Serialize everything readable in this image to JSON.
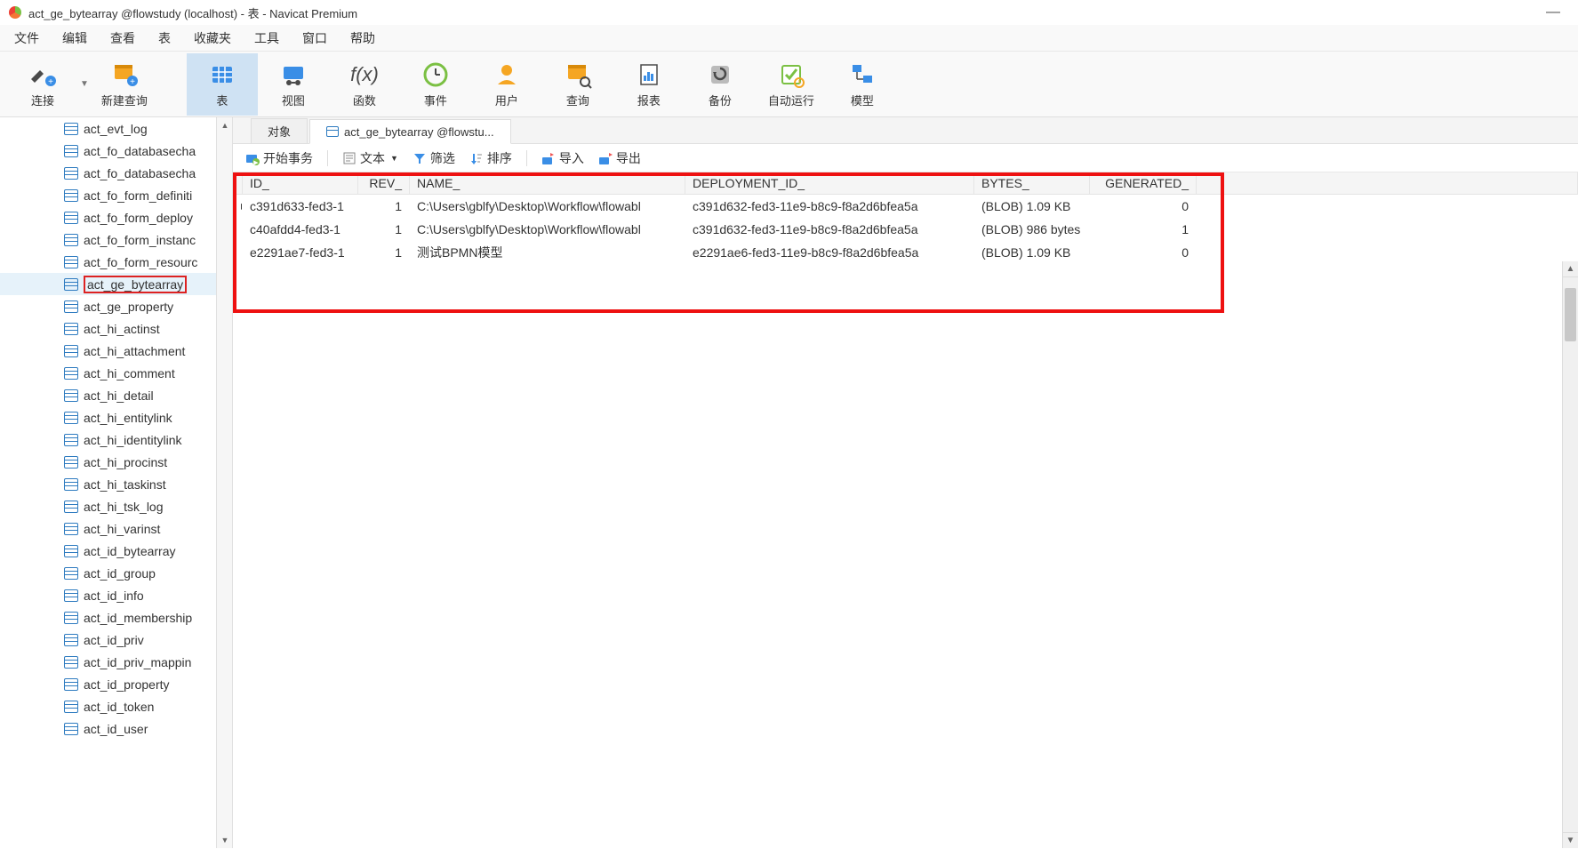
{
  "window": {
    "title": "act_ge_bytearray @flowstudy (localhost) - 表 - Navicat Premium",
    "minimize": "—"
  },
  "menu": [
    "文件",
    "编辑",
    "查看",
    "表",
    "收藏夹",
    "工具",
    "窗口",
    "帮助"
  ],
  "toolbar": [
    {
      "label": "连接",
      "icon": "plug"
    },
    {
      "label": "新建查询",
      "icon": "new-query"
    },
    {
      "label": "表",
      "icon": "table",
      "active": true
    },
    {
      "label": "视图",
      "icon": "view"
    },
    {
      "label": "函数",
      "icon": "fx"
    },
    {
      "label": "事件",
      "icon": "event"
    },
    {
      "label": "用户",
      "icon": "user"
    },
    {
      "label": "查询",
      "icon": "query"
    },
    {
      "label": "报表",
      "icon": "report"
    },
    {
      "label": "备份",
      "icon": "backup"
    },
    {
      "label": "自动运行",
      "icon": "autorun"
    },
    {
      "label": "模型",
      "icon": "model"
    }
  ],
  "sidebar": {
    "items": [
      "act_evt_log",
      "act_fo_databasecha",
      "act_fo_databasecha",
      "act_fo_form_definiti",
      "act_fo_form_deploy",
      "act_fo_form_instanc",
      "act_fo_form_resourc",
      "act_ge_bytearray",
      "act_ge_property",
      "act_hi_actinst",
      "act_hi_attachment",
      "act_hi_comment",
      "act_hi_detail",
      "act_hi_entitylink",
      "act_hi_identitylink",
      "act_hi_procinst",
      "act_hi_taskinst",
      "act_hi_tsk_log",
      "act_hi_varinst",
      "act_id_bytearray",
      "act_id_group",
      "act_id_info",
      "act_id_membership",
      "act_id_priv",
      "act_id_priv_mappin",
      "act_id_property",
      "act_id_token",
      "act_id_user"
    ],
    "selected_index": 7
  },
  "tabs": [
    {
      "label": "对象",
      "active": false
    },
    {
      "label": "act_ge_bytearray @flowstu...",
      "active": true
    }
  ],
  "subtoolbar": {
    "begin_txn": "开始事务",
    "text": "文本",
    "filter": "筛选",
    "sort": "排序",
    "import": "导入",
    "export": "导出"
  },
  "grid": {
    "columns": [
      "ID_",
      "REV_",
      "NAME_",
      "DEPLOYMENT_ID_",
      "BYTES_",
      "GENERATED_"
    ],
    "rows": [
      {
        "id": "c391d633-fed3-1",
        "rev": "1",
        "name": "C:\\Users\\gblfy\\Desktop\\Workflow\\flowabl",
        "deploy": "c391d632-fed3-11e9-b8c9-f8a2d6bfea5a",
        "bytes": "(BLOB) 1.09 KB",
        "gen": "0",
        "current": true
      },
      {
        "id": "c40afdd4-fed3-1",
        "rev": "1",
        "name": "C:\\Users\\gblfy\\Desktop\\Workflow\\flowabl",
        "deploy": "c391d632-fed3-11e9-b8c9-f8a2d6bfea5a",
        "bytes": "(BLOB) 986 bytes",
        "gen": "1"
      },
      {
        "id": "e2291ae7-fed3-1",
        "rev": "1",
        "name": "测试BPMN模型",
        "deploy": "e2291ae6-fed3-11e9-b8c9-f8a2d6bfea5a",
        "bytes": "(BLOB) 1.09 KB",
        "gen": "0"
      }
    ]
  }
}
